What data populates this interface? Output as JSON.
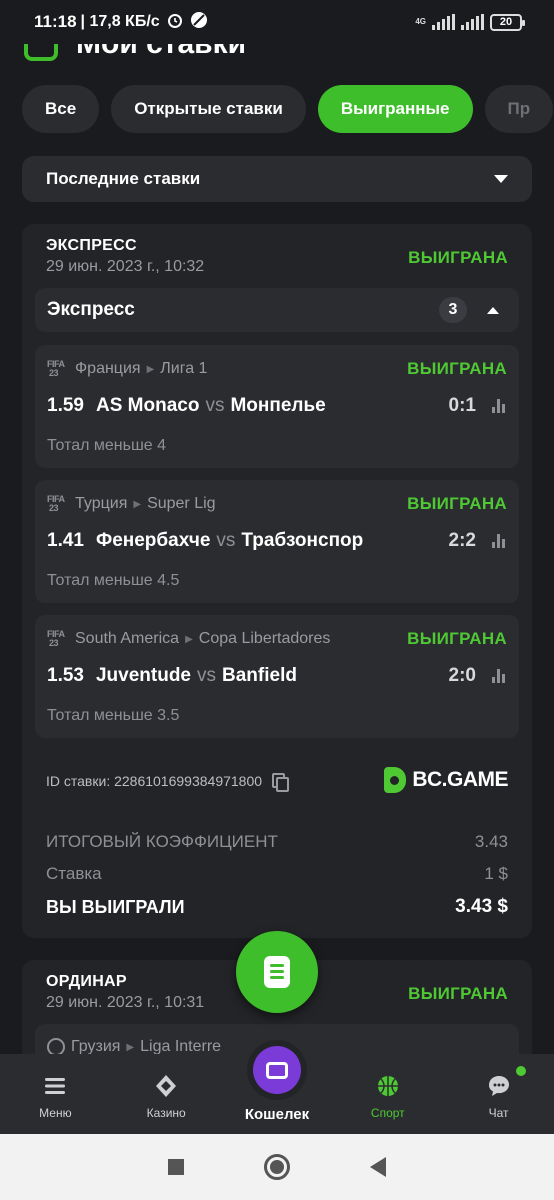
{
  "status_bar": {
    "time": "11:18",
    "speed": "| 17,8 КБ/с",
    "network": "4G",
    "battery": "20"
  },
  "header": {
    "title": "Мои ставки",
    "icon": "bets-icon"
  },
  "tabs": [
    {
      "label": "Все",
      "active": false
    },
    {
      "label": "Открытые ставки",
      "active": false
    },
    {
      "label": "Выигранные",
      "active": true
    },
    {
      "label": "Пр",
      "active": false
    }
  ],
  "filter": {
    "label": "Последние ставки"
  },
  "bet1": {
    "type": "ЭКСПРЕСС",
    "date": "29 июн. 2023 г., 10:32",
    "status": "ВЫИГРАНА",
    "express_label": "Экспресс",
    "express_count": "3",
    "events": [
      {
        "sport_icon": "fifa-icon",
        "country": "Франция",
        "league": "Лига 1",
        "status": "ВЫИГРАНА",
        "odd": "1.59",
        "team1": "AS Monaco",
        "vs": "vs",
        "team2": "Монпелье",
        "score": "0:1",
        "market": "Тотал меньше 4"
      },
      {
        "sport_icon": "fifa-icon",
        "country": "Турция",
        "league": "Super Lig",
        "status": "ВЫИГРАНА",
        "odd": "1.41",
        "team1": "Фенербахче",
        "vs": "vs",
        "team2": "Трабзонспор",
        "score": "2:2",
        "market": "Тотал меньше 4.5"
      },
      {
        "sport_icon": "fifa-icon",
        "country": "South America",
        "league": "Copa Libertadores",
        "status": "ВЫИГРАНА",
        "odd": "1.53",
        "team1": "Juventude",
        "vs": "vs",
        "team2": "Banfield",
        "score": "2:0",
        "market": "Тотал меньше 3.5"
      }
    ],
    "bet_id": "ID ставки: 2286101699384971800",
    "brand": "BC.GAME",
    "total_coef_label": "ИТОГОВЫЙ КОЭФФИЦИЕНТ",
    "total_coef": "3.43",
    "stake_label": "Ставка",
    "stake": "1 $",
    "win_label": "ВЫ ВЫИГРАЛИ",
    "win": "3.43 $"
  },
  "bet2": {
    "type": "ОРДИНАР",
    "date": "29 июн. 2023 г., 10:31",
    "status": "ВЫИГРАНА",
    "event": {
      "sport_icon": "soccer-ball-icon",
      "country": "Грузия",
      "league": "Liga Interre"
    }
  },
  "bottom_nav": [
    {
      "label": "Меню",
      "icon": "menu-icon",
      "active": false
    },
    {
      "label": "Казино",
      "icon": "casino-icon",
      "active": false
    },
    {
      "label": "Кошелек",
      "icon": "wallet-icon",
      "active": false
    },
    {
      "label": "Спорт",
      "icon": "sport-icon",
      "active": true
    },
    {
      "label": "Чат",
      "icon": "chat-icon",
      "active": false
    }
  ],
  "colors": {
    "accent": "#3fbe2b",
    "won": "#4ec933",
    "background": "#1a1b1e",
    "card": "#232427",
    "wallet": "#7a3bd8"
  }
}
